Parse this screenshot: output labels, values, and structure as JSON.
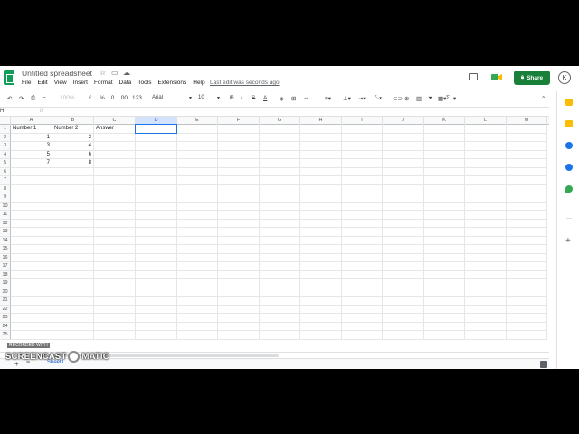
{
  "header": {
    "title": "Untitled spreadsheet",
    "menu": [
      "File",
      "Edit",
      "View",
      "Insert",
      "Format",
      "Data",
      "Tools",
      "Extensions",
      "Help"
    ],
    "last_edit": "Last edit was seconds ago",
    "share_label": "Share",
    "avatar_letter": "K"
  },
  "toolbar": {
    "zoom": "100%",
    "currency": "£",
    "percent": "%",
    "decimal_decrease": ".0",
    "decimal_increase": ".00",
    "more_formats": "123",
    "font": "Arial",
    "font_size": "10",
    "bold": "B",
    "italic": "I",
    "strikethrough": "S",
    "text_color": "A",
    "sum": "Σ"
  },
  "formula_bar": {
    "name_box": "H",
    "fx": "fx"
  },
  "grid": {
    "columns": [
      "A",
      "B",
      "C",
      "D",
      "E",
      "F",
      "G",
      "H",
      "I",
      "J",
      "K",
      "L",
      "M"
    ],
    "rows": [
      "1",
      "2",
      "3",
      "4",
      "5",
      "6",
      "7",
      "8",
      "9",
      "10",
      "11",
      "12",
      "13",
      "14",
      "15",
      "16",
      "17",
      "18",
      "19",
      "20",
      "21",
      "22",
      "23",
      "24",
      "25"
    ],
    "cells": {
      "A1": "Number 1",
      "B1": "Number 2",
      "C1": "Answer",
      "A2": "1",
      "B2": "2",
      "A3": "3",
      "B3": "4",
      "A4": "5",
      "B4": "6",
      "A5": "7",
      "B5": "8"
    },
    "selected_column": "D"
  },
  "sheetbar": {
    "add": "+",
    "all_sheets": "≡",
    "sheet_name": "Sheet1"
  },
  "watermark": {
    "small": "RECORDED WITH",
    "big_left": "SCREENCAST",
    "big_right": "MATIC"
  },
  "colors": {
    "share": "#188038",
    "selection": "#1a73e8",
    "logo": "#0f9d58"
  }
}
